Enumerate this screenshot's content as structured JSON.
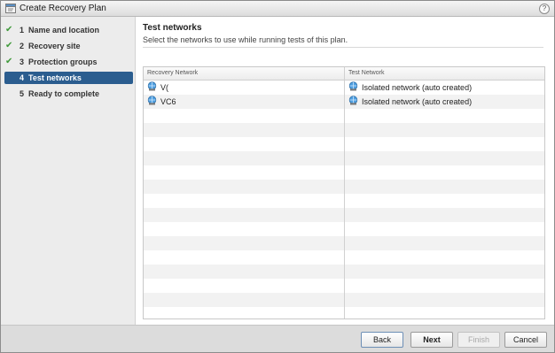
{
  "window": {
    "title": "Create Recovery Plan",
    "help_label": "?"
  },
  "sidebar": {
    "steps": [
      {
        "num": "1",
        "label": "Name and location",
        "status": "done"
      },
      {
        "num": "2",
        "label": "Recovery site",
        "status": "done"
      },
      {
        "num": "3",
        "label": "Protection groups",
        "status": "done"
      },
      {
        "num": "4",
        "label": "Test networks",
        "status": "active"
      },
      {
        "num": "5",
        "label": "Ready to complete",
        "status": "pending"
      }
    ],
    "check_glyph": "✔"
  },
  "main": {
    "title": "Test networks",
    "subtitle": "Select the networks to use while running tests of this plan.",
    "table": {
      "columns": [
        "Recovery Network",
        "Test Network"
      ],
      "rows": [
        {
          "recovery_network": "V(",
          "test_network": "Isolated network (auto created)"
        },
        {
          "recovery_network": "VC6",
          "test_network": "Isolated network (auto created)"
        }
      ]
    }
  },
  "footer": {
    "back_label": "Back",
    "next_label": "Next",
    "finish_label": "Finish",
    "cancel_label": "Cancel"
  },
  "colors": {
    "active_step": "#2b5d8f",
    "check": "#3f9a3a",
    "network_icon": "#2e6fa8"
  },
  "icons": {
    "title": "recovery-plan-icon",
    "network": "network-icon",
    "done": "check-icon"
  }
}
